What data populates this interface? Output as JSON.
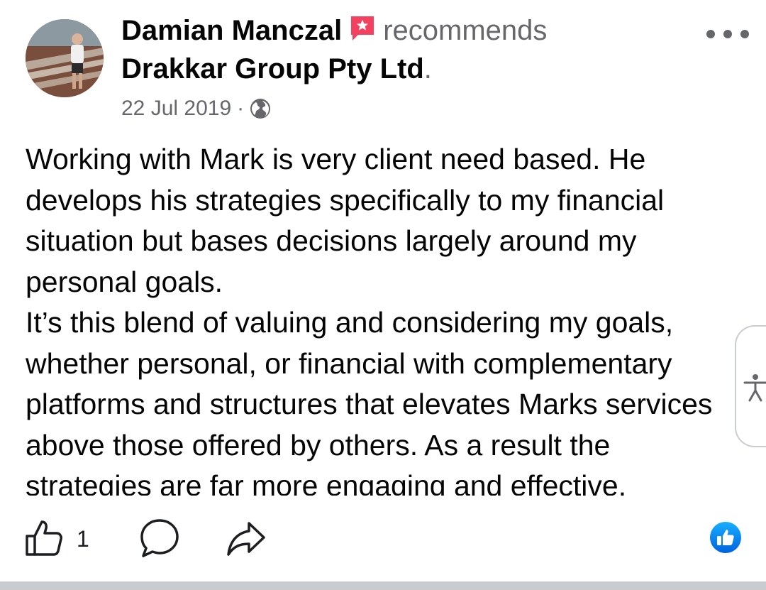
{
  "post": {
    "author": "Damian Manczal",
    "verb": "recommends",
    "page_name": "Drakkar Group Pty Ltd",
    "period": ".",
    "date": "22 Jul 2019",
    "separator": "·",
    "privacy_icon": "globe-icon",
    "body_paragraphs": [
      "Working with Mark is very client need based. He develops his strategies specifically to my financial situation but bases decisions largely around my personal goals.",
      "It’s this blend of valuing and considering my goals, whether personal, or financial with complementary platforms and structures that elevates Marks services above those offered by others. As a result the strategies are far more engaging and effective."
    ]
  },
  "actions": {
    "like_count": "1",
    "like_icon": "thumbs-up-icon",
    "comment_icon": "comment-icon",
    "share_icon": "share-icon",
    "reaction_icon": "like-reaction-icon"
  },
  "colors": {
    "recommend_badge": "#f3425f",
    "like_blue": "#1877f2",
    "secondary_text": "#65676b",
    "primary_text": "#050505"
  }
}
